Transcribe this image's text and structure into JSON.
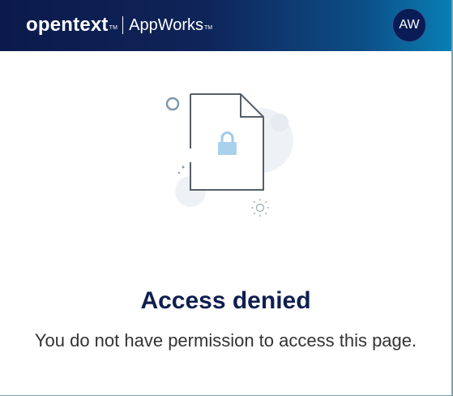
{
  "header": {
    "brand": "opentext",
    "brand_tm": "TM",
    "product": "AppWorks",
    "product_tm": "TM",
    "avatar_initials": "AW"
  },
  "content": {
    "title": "Access denied",
    "message": "You do not have permission to access this page."
  },
  "colors": {
    "header_dark": "#0b1a4b",
    "header_light": "#087fb4",
    "title": "#0f1f4f",
    "lock": "#9fcbe8"
  },
  "icons": [
    "locked-document-illustration"
  ]
}
